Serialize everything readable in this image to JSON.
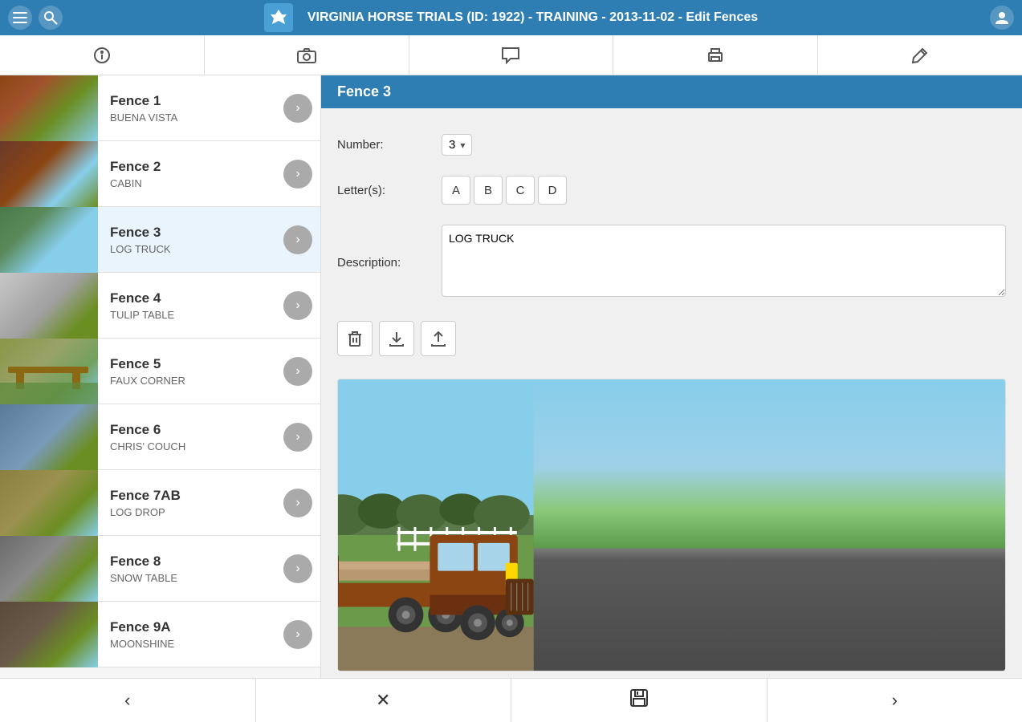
{
  "header": {
    "title": "VIRGINIA HORSE TRIALS (ID: 1922) - TRAINING - 2013-11-02 - Edit Fences",
    "logo_alt": "horse-logo"
  },
  "tabs": [
    {
      "id": "info",
      "icon": "ℹ",
      "label": "Info"
    },
    {
      "id": "camera",
      "icon": "📷",
      "label": "Camera"
    },
    {
      "id": "chat",
      "icon": "💬",
      "label": "Comments"
    },
    {
      "id": "print",
      "icon": "🖨",
      "label": "Print"
    },
    {
      "id": "edit",
      "icon": "✏",
      "label": "Edit"
    }
  ],
  "fences": [
    {
      "id": 1,
      "name": "Fence 1",
      "desc": "BUENA VISTA",
      "thumb_class": "fence-thumb-1"
    },
    {
      "id": 2,
      "name": "Fence 2",
      "desc": "CABIN",
      "thumb_class": "fence-thumb-2"
    },
    {
      "id": 3,
      "name": "Fence 3",
      "desc": "LOG TRUCK",
      "thumb_class": "fence-thumb-3",
      "active": true
    },
    {
      "id": 4,
      "name": "Fence 4",
      "desc": "TULIP TABLE",
      "thumb_class": "fence-thumb-4"
    },
    {
      "id": 5,
      "name": "Fence 5",
      "desc": "FAUX CORNER",
      "thumb_class": "fence-thumb-5"
    },
    {
      "id": 6,
      "name": "Fence 6",
      "desc": "CHRIS' COUCH",
      "thumb_class": "fence-thumb-6"
    },
    {
      "id": 7,
      "name": "Fence 7AB",
      "desc": "LOG DROP",
      "thumb_class": "fence-thumb-7"
    },
    {
      "id": 8,
      "name": "Fence 8",
      "desc": "SNOW TABLE",
      "thumb_class": "fence-thumb-8"
    },
    {
      "id": 9,
      "name": "Fence 9A",
      "desc": "MOONSHINE",
      "thumb_class": "fence-thumb-9"
    }
  ],
  "detail": {
    "title": "Fence 3",
    "number_label": "Number:",
    "number_value": "3",
    "letters_label": "Letter(s):",
    "letters": [
      "A",
      "B",
      "C",
      "D"
    ],
    "description_label": "Description:",
    "description_value": "LOG TRUCK",
    "action_buttons": [
      {
        "id": "delete",
        "icon": "🗑",
        "label": "Delete"
      },
      {
        "id": "download",
        "icon": "⬇",
        "label": "Download"
      },
      {
        "id": "upload",
        "icon": "⬆",
        "label": "Upload"
      }
    ]
  },
  "bottom_bar": {
    "prev_label": "‹",
    "cancel_label": "✕",
    "save_label": "💾",
    "next_label": "›"
  }
}
